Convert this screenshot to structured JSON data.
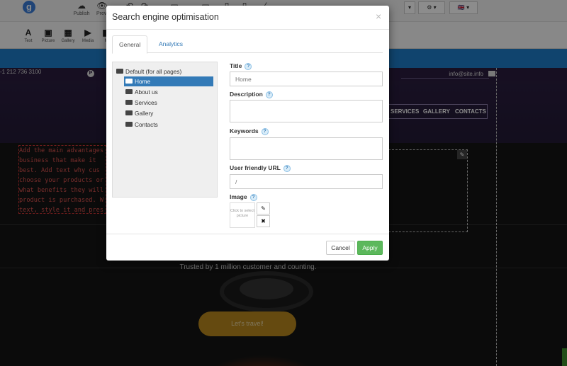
{
  "editor": {
    "toolbar": {
      "publish_label": "Publish",
      "preview_label": "Previ",
      "extra_label": "M"
    },
    "widgets": [
      {
        "label": "Text",
        "icon": "A"
      },
      {
        "label": "Picture",
        "icon": "▣"
      },
      {
        "label": "Gallery",
        "icon": "▦"
      },
      {
        "label": "Media",
        "icon": "▶"
      },
      {
        "label": "M",
        "icon": "◧"
      }
    ],
    "language_flag": "🇬🇧"
  },
  "site": {
    "phone": "-1 212 736 3100",
    "email": "info@site.info",
    "menu": [
      "SERVICES",
      "GALLERY",
      "CONTACTS"
    ],
    "hero_text": "Add the main advantages business that make it best. Add text why cus choose your products or what benefits they will product is purchased. W text, style it and pres",
    "trusted_text": "Trusted by 1 million customer and counting.",
    "cta_label": "Let's travel!"
  },
  "modal": {
    "title": "Search engine optimisation",
    "close_glyph": "×",
    "tabs": [
      {
        "label": "General",
        "active": true
      },
      {
        "label": "Analytics",
        "active": false
      }
    ],
    "tree": [
      {
        "label": "Default (for all pages)",
        "level": 0,
        "selected": false
      },
      {
        "label": "Home",
        "level": 1,
        "selected": true
      },
      {
        "label": "About us",
        "level": 1,
        "selected": false
      },
      {
        "label": "Services",
        "level": 1,
        "selected": false
      },
      {
        "label": "Gallery",
        "level": 1,
        "selected": false
      },
      {
        "label": "Contacts",
        "level": 1,
        "selected": false
      }
    ],
    "fields": {
      "title_label": "Title",
      "title_placeholder": "Home",
      "description_label": "Description",
      "description_value": "",
      "keywords_label": "Keywords",
      "keywords_value": "",
      "url_label": "User friendly URL",
      "url_placeholder": "/",
      "image_label": "Image",
      "image_placeholder": "Click to select picture"
    },
    "help_glyph": "?",
    "cancel_label": "Cancel",
    "apply_label": "Apply"
  },
  "colors": {
    "primary": "#337ab7",
    "apply": "#5cb85c",
    "editor_blue": "#1e7cc9",
    "cta": "#b8871e"
  }
}
